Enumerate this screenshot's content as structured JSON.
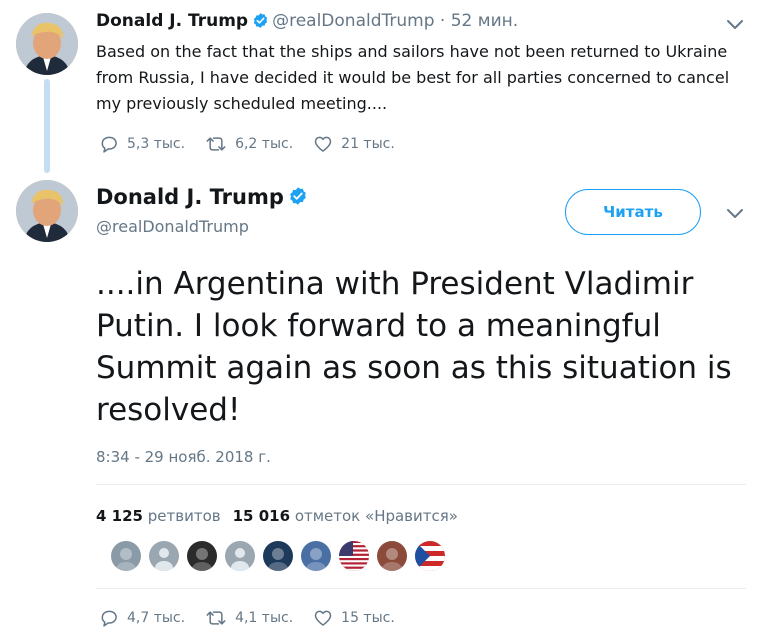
{
  "thread_tweet": {
    "name": "Donald J. Trump",
    "handle": "@realDonaldTrump",
    "separator": "·",
    "time": "52 мин.",
    "text": "Based on the fact that the ships and sailors have not been returned to Ukraine from Russia, I have decided it would be best for all parties concerned to cancel my previously scheduled meeting....",
    "replies": "5,3 тыс.",
    "retweets": "6,2 тыс.",
    "likes": "21 тыс."
  },
  "main_tweet": {
    "name": "Donald J. Trump",
    "handle": "@realDonaldTrump",
    "follow_label": "Читать",
    "text": "....in Argentina with President Vladimir Putin. I look forward to a meaningful Summit again as soon as this situation is resolved!",
    "date": "8:34 - 29 нояб. 2018 г.",
    "retweet_count": "4 125",
    "retweet_label": "ретвитов",
    "like_count": "15 016",
    "like_label": "отметок «Нравится»",
    "replies": "4,7 тыс.",
    "retweets": "4,1 тыс.",
    "likes": "15 тыс."
  },
  "likers": [
    {
      "icon": "avatar-photo-1",
      "color": "#8a9aa6"
    },
    {
      "icon": "default-avatar",
      "color": "#9aa7b1"
    },
    {
      "icon": "avatar-photo-3",
      "color": "#2b2b2b"
    },
    {
      "icon": "default-avatar",
      "color": "#9aa7b1"
    },
    {
      "icon": "avatar-photo-5",
      "color": "#1e3a5a"
    },
    {
      "icon": "avatar-photo-6",
      "color": "#4a6fa5"
    },
    {
      "icon": "us-flag-avatar",
      "color": "#b22234"
    },
    {
      "icon": "avatar-photo-8",
      "color": "#8b4a3a"
    },
    {
      "icon": "flag-avatar",
      "color": "#cc2a2a"
    }
  ],
  "colors": {
    "accent": "#1da1f2",
    "secondary_text": "#657786",
    "thread_line": "#c4ddf3"
  }
}
